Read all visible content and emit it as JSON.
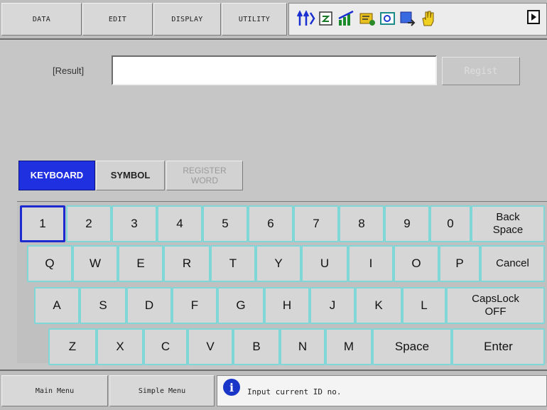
{
  "menubar": {
    "tabs": [
      "DATA",
      "EDIT",
      "DISPLAY",
      "UTILITY"
    ]
  },
  "toolbar_icons": [
    "shift-arrows-icon",
    "clipboard-icon",
    "signal-chart-icon",
    "program-icon",
    "camera-icon",
    "export-icon",
    "hand-icon",
    "play-icon"
  ],
  "input": {
    "result_label": "[Result]",
    "result_value": "",
    "regist_label": "Regist"
  },
  "mode_tabs": {
    "keyboard": "KEYBOARD",
    "symbol": "SYMBOL",
    "register_line1": "REGISTER",
    "register_line2": "WORD"
  },
  "keys": {
    "row1": [
      "1",
      "2",
      "3",
      "4",
      "5",
      "6",
      "7",
      "8",
      "9",
      "0"
    ],
    "backspace": [
      "Back",
      "Space"
    ],
    "row2": [
      "Q",
      "W",
      "E",
      "R",
      "T",
      "Y",
      "U",
      "I",
      "O",
      "P"
    ],
    "cancel": "Cancel",
    "row3": [
      "A",
      "S",
      "D",
      "F",
      "G",
      "H",
      "J",
      "K",
      "L"
    ],
    "capslock": [
      "CapsLock",
      "OFF"
    ],
    "row4": [
      "Z",
      "X",
      "C",
      "V",
      "B",
      "N",
      "M"
    ],
    "space": "Space",
    "enter": "Enter"
  },
  "bottombar": {
    "main_menu": "Main Menu",
    "simple_menu": "Simple Menu"
  },
  "message": {
    "icon": "i",
    "text": "Input current ID no."
  },
  "colors": {
    "active_tab": "#1f30e0",
    "key_border": "#7fd7d7",
    "selected_key_border": "#1d2ad0"
  }
}
